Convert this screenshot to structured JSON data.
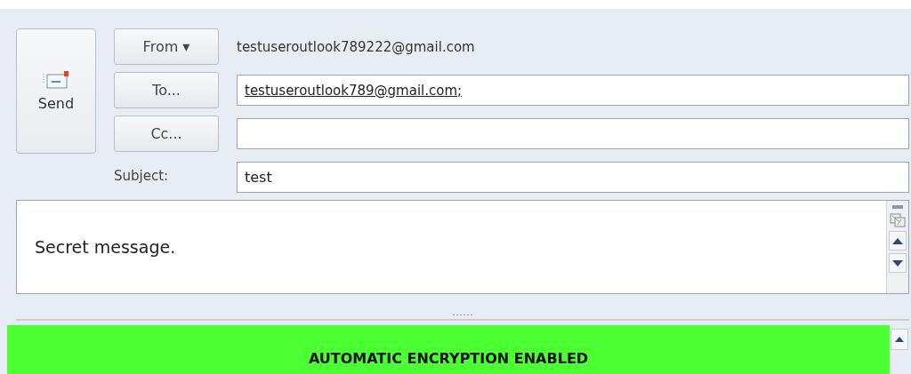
{
  "send_button": {
    "label": "Send"
  },
  "from": {
    "label": "From ▾",
    "value": "testuseroutlook789222@gmail.com"
  },
  "to": {
    "label": "To...",
    "value": "testuseroutlook789@gmail.com;"
  },
  "cc": {
    "label": "Cc..."
  },
  "subject": {
    "label": "Subject:",
    "value": "test"
  },
  "body": {
    "text": "Secret message."
  },
  "banner": {
    "text": "AUTOMATIC ENCRYPTION ENABLED",
    "color": "#4cff33"
  }
}
